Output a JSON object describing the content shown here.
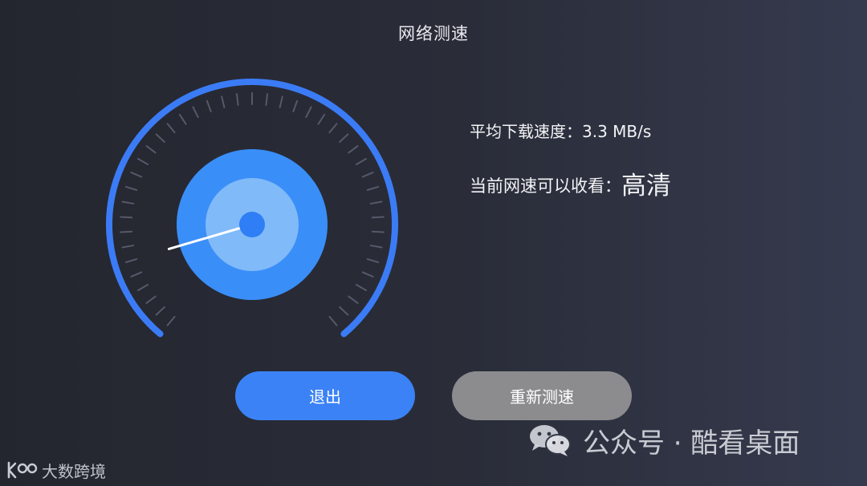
{
  "header": {
    "title": "网络测速"
  },
  "gauge": {
    "needle_fraction": 0.12,
    "colors": {
      "arc": "#3b7cf6",
      "outer_disc": "#3a8ef8",
      "inner_disc": "#80baf8",
      "hub": "#2f7ef6",
      "needle": "#ffffff",
      "ticks": "#55596a"
    }
  },
  "info": {
    "speed_label": "平均下载速度：",
    "speed_value": "3.3 MB/s",
    "quality_label": "当前网速可以收看：",
    "quality_value": "高清"
  },
  "buttons": {
    "exit_label": "退出",
    "retest_label": "重新测速",
    "exit_color": "#3b82f6",
    "retest_color": "#8c8c8f"
  },
  "watermark": {
    "icon": "wechat-icon",
    "text": "公众号 · 酷看桌面"
  },
  "brand": {
    "logo": "brand-logo",
    "text": "大数跨境"
  }
}
